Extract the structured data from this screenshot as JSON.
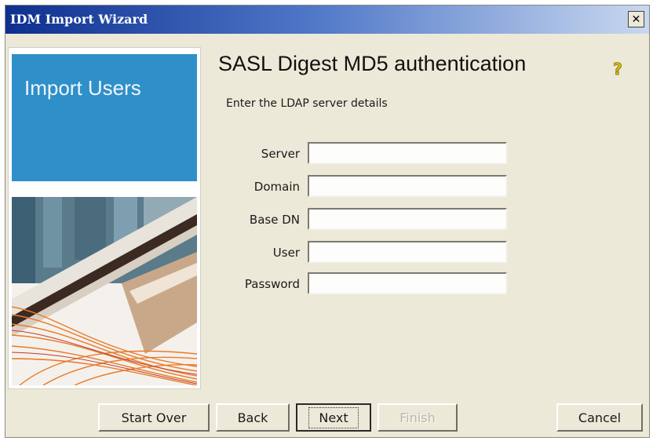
{
  "window": {
    "title": "IDM Import Wizard",
    "close_label": "✕"
  },
  "sidebar": {
    "title": "Import Users"
  },
  "main": {
    "heading": "SASL Digest MD5 authentication",
    "help_icon": "help-question-icon",
    "instructions": "Enter the LDAP server details"
  },
  "form": {
    "server_label": "Server",
    "server_value": "",
    "domain_label": "Domain",
    "domain_value": "",
    "basedn_label": "Base DN",
    "basedn_value": "",
    "user_label": "User",
    "user_value": "",
    "password_label": "Password",
    "password_value": ""
  },
  "buttons": {
    "start_over": "Start Over",
    "back": "Back",
    "next": "Next",
    "finish": "Finish",
    "cancel": "Cancel"
  },
  "colors": {
    "titlebar": "#0d2f8f",
    "sidebar_accent": "#2f8fc9",
    "dialog": "#ece9d8"
  }
}
